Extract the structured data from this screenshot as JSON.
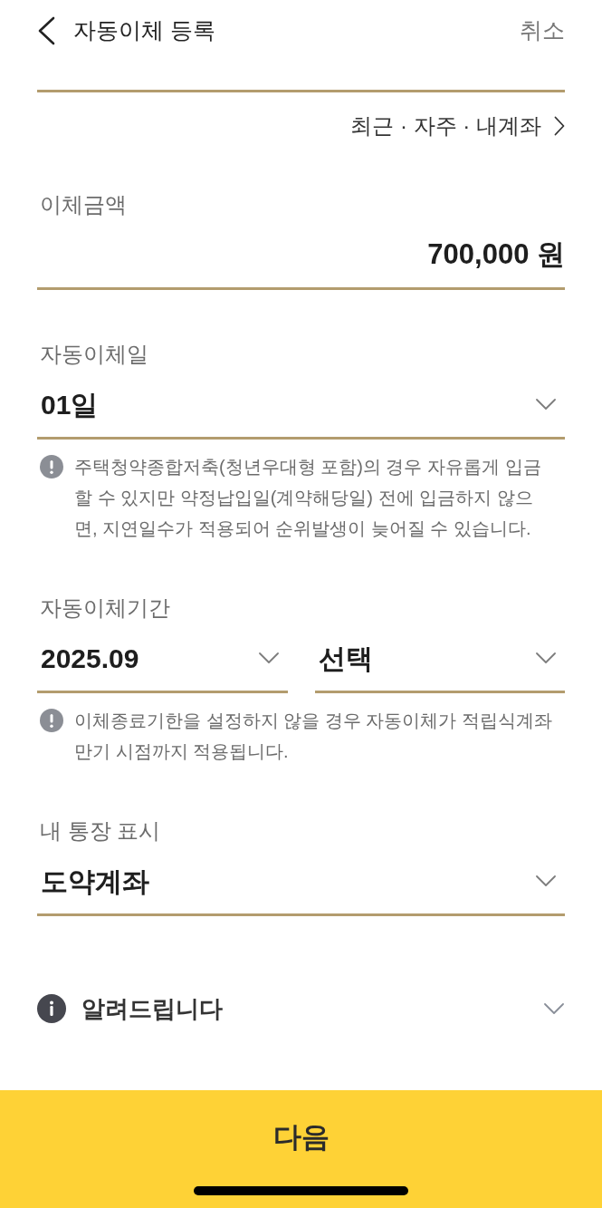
{
  "header": {
    "title": "자동이체 등록",
    "cancel": "취소"
  },
  "account": {
    "shortcut": "최근 · 자주 · 내계좌"
  },
  "sections": [
    {
      "kind": "amount",
      "label": "이체금액",
      "value": "700,000 원"
    },
    {
      "kind": "select",
      "label": "자동이체일",
      "selects": [
        "01일"
      ],
      "notice": "주택청약종합저축(청년우대형 포함)의 경우 자유롭게 입금할 수 있지만 약정납입일(계약해당일) 전에 입금하지 않으면, 지연일수가 적용되어 순위발생이 늦어질 수 있습니다."
    },
    {
      "kind": "select",
      "label": "자동이체기간",
      "selects": [
        "2025.09",
        "선택"
      ],
      "notice": "이체종료기한을 설정하지 않을 경우 자동이체가 적립식계좌 만기 시점까지 적용됩니다."
    },
    {
      "kind": "select",
      "label": "내 통장 표시",
      "selects": [
        "도약계좌"
      ]
    }
  ],
  "info": {
    "title": "알려드립니다"
  },
  "next_button": {
    "label": "다음"
  }
}
